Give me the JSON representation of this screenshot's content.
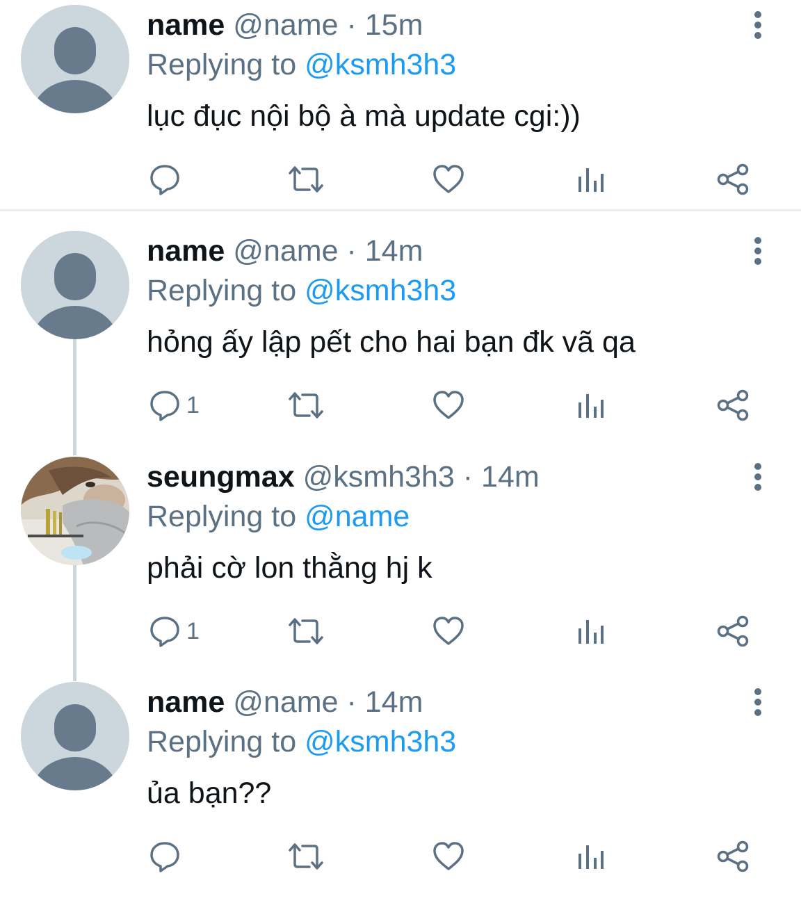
{
  "colors": {
    "text": "#0f1419",
    "secondary": "#5b7083",
    "accent": "#1d9bf0",
    "avatar_placeholder": "#ccd6dd",
    "avatar_silhouette": "#687b8c",
    "divider": "#e6ecf0"
  },
  "replying_label": "Replying to",
  "separator": "·",
  "tweets": [
    {
      "name": "name",
      "handle": "@name",
      "time": "15m",
      "replying_to": "@ksmh3h3",
      "text": "lục đục nội bộ à mà update cgi:))",
      "reply_count": "",
      "avatar": "default-avatar"
    },
    {
      "name": "name",
      "handle": "@name",
      "time": "14m",
      "replying_to": "@ksmh3h3",
      "text": "hỏng ấy lập pết cho hai bạn đk vã qa",
      "reply_count": "1",
      "avatar": "default-avatar"
    },
    {
      "name": "seungmax",
      "handle": "@ksmh3h3",
      "time": "14m",
      "replying_to": "@name",
      "text": "phải cờ lon thằng hj k",
      "reply_count": "1",
      "avatar": "photo-avatar"
    },
    {
      "name": "name",
      "handle": "@name",
      "time": "14m",
      "replying_to": "@ksmh3h3",
      "text": "ủa bạn??",
      "reply_count": "",
      "avatar": "default-avatar"
    }
  ],
  "icons": {
    "reply": "reply-icon",
    "retweet": "retweet-icon",
    "like": "heart-icon",
    "analytics": "analytics-icon",
    "share": "share-icon",
    "more": "more-vertical-icon"
  }
}
